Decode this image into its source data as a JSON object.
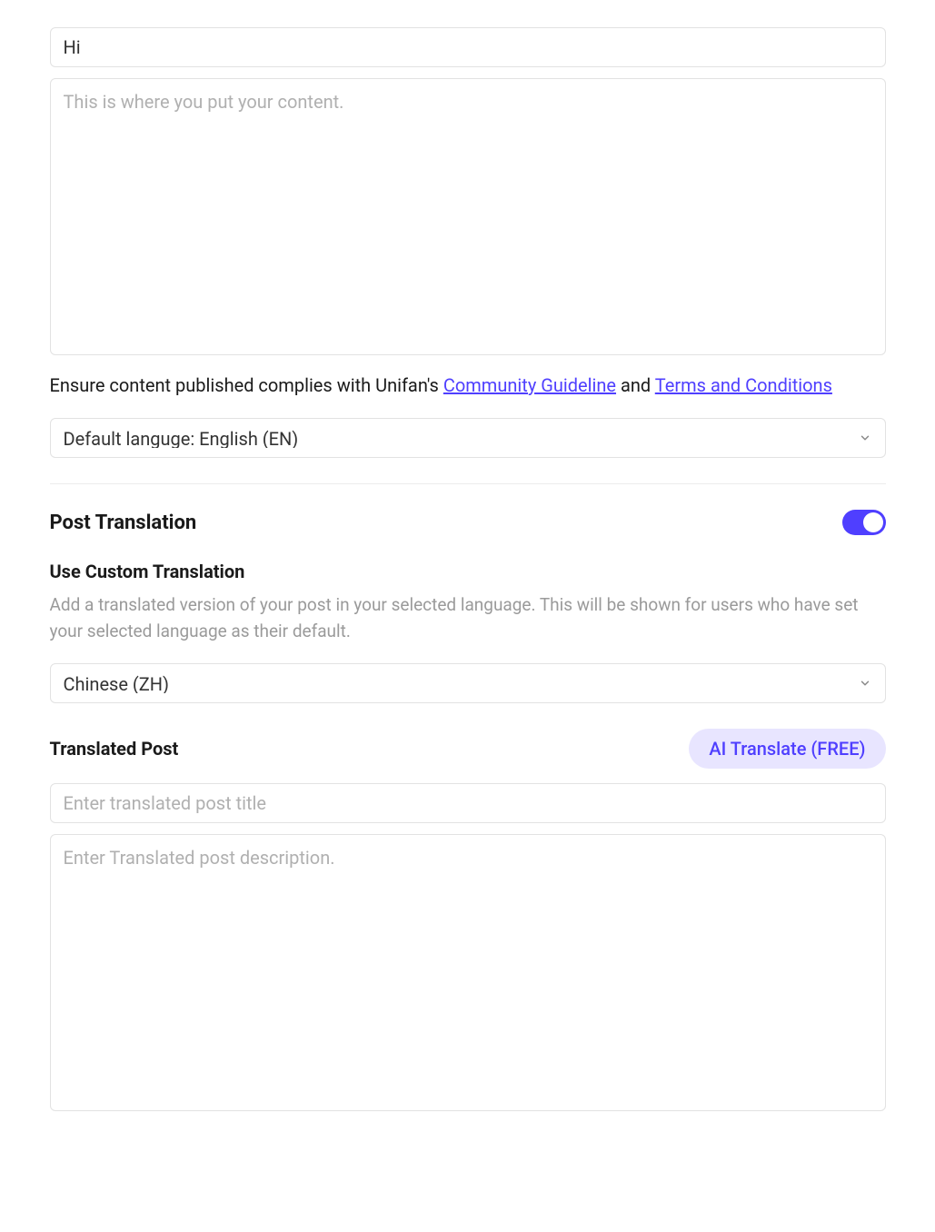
{
  "post": {
    "title": "Hi",
    "content_placeholder": "This is where you put your content."
  },
  "compliance": {
    "prefix": "Ensure content published complies with Unifan's ",
    "link1": "Community Guideline",
    "joiner": " and ",
    "link2": "Terms and Conditions"
  },
  "default_language": {
    "selected": "Default languge: English (EN)"
  },
  "translation": {
    "section_title": "Post Translation",
    "custom_title": "Use Custom Translation",
    "help_text": "Add a translated version of your post in your selected language. This will be shown for users who have set your selected language as their default.",
    "language_selected": "Chinese (ZH)",
    "translated_label": "Translated Post",
    "ai_button": "AI Translate (FREE)",
    "title_placeholder": "Enter translated post title",
    "description_placeholder": "Enter Translated post description."
  }
}
